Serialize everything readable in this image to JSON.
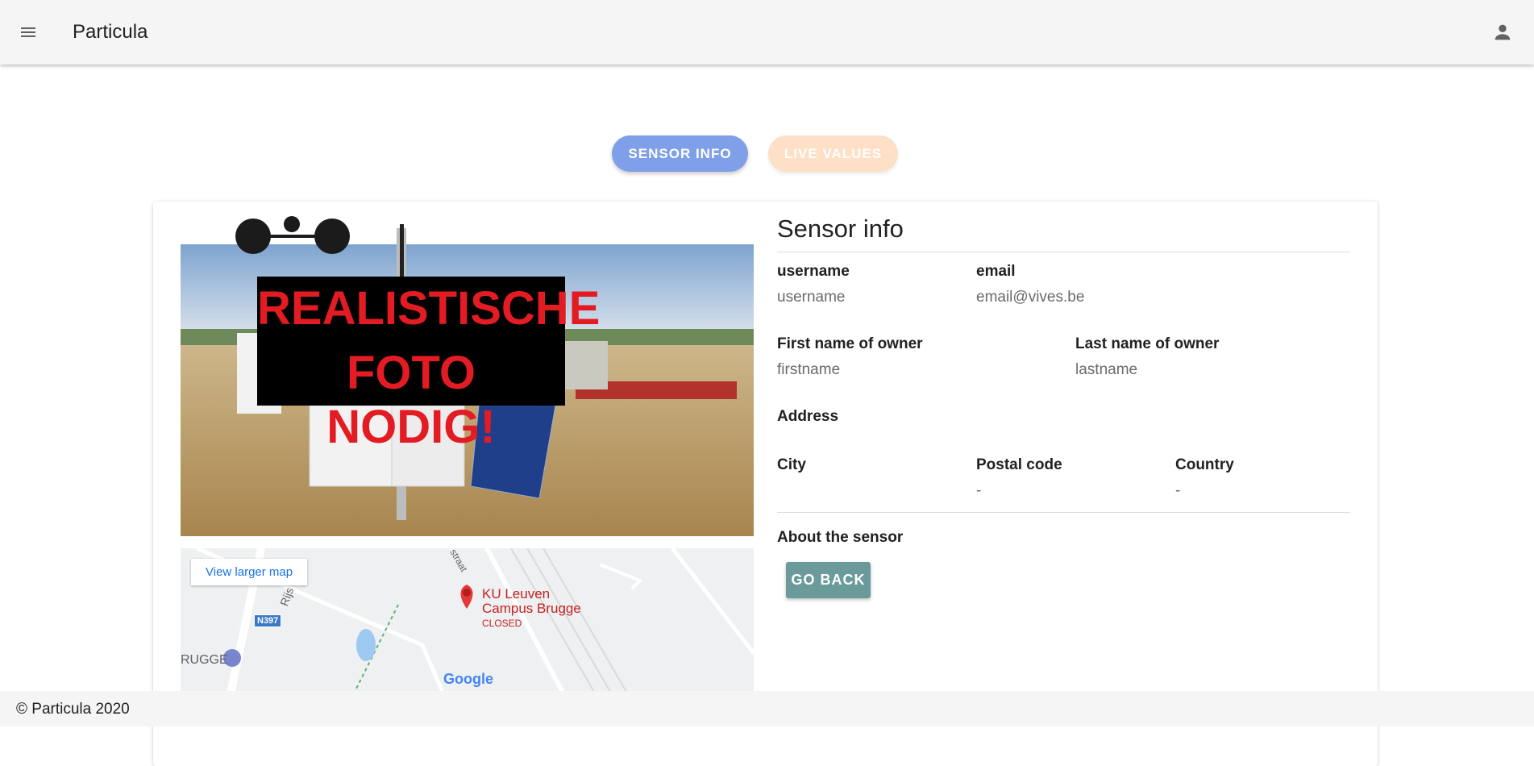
{
  "header": {
    "title": "Particula",
    "menu_icon": "menu-icon",
    "account_icon": "account-icon"
  },
  "tabs": [
    {
      "label": "SENSOR INFO",
      "active": true,
      "color": "#7f9fe8"
    },
    {
      "label": "LIVE VALUES",
      "active": false,
      "color": "#fde0c6"
    }
  ],
  "photo": {
    "overlay_line1": "REALISTISCHE",
    "overlay_line2": "FOTO NODIG!"
  },
  "map": {
    "link": "View larger map",
    "place_name_1": "KU Leuven",
    "place_name_2": "Campus Brugge",
    "place_status": "CLOSED",
    "town": "RUGGE",
    "road": "N397",
    "street_1": "Rijs",
    "street_2": "straat",
    "brand": "Google"
  },
  "sensor_info": {
    "title": "Sensor info",
    "username_label": "username",
    "username_value": "username",
    "email_label": "email",
    "email_value": "email@vives.be",
    "firstname_label": "First name of owner",
    "firstname_value": "firstname",
    "lastname_label": "Last name of owner",
    "lastname_value": "lastname",
    "address_label": "Address",
    "city_label": "City",
    "postal_label": "Postal code",
    "postal_value": "-",
    "country_label": "Country",
    "country_value": "-",
    "about_label": "About the sensor",
    "back_label": "GO BACK"
  },
  "footer": {
    "text": "© Particula 2020"
  }
}
